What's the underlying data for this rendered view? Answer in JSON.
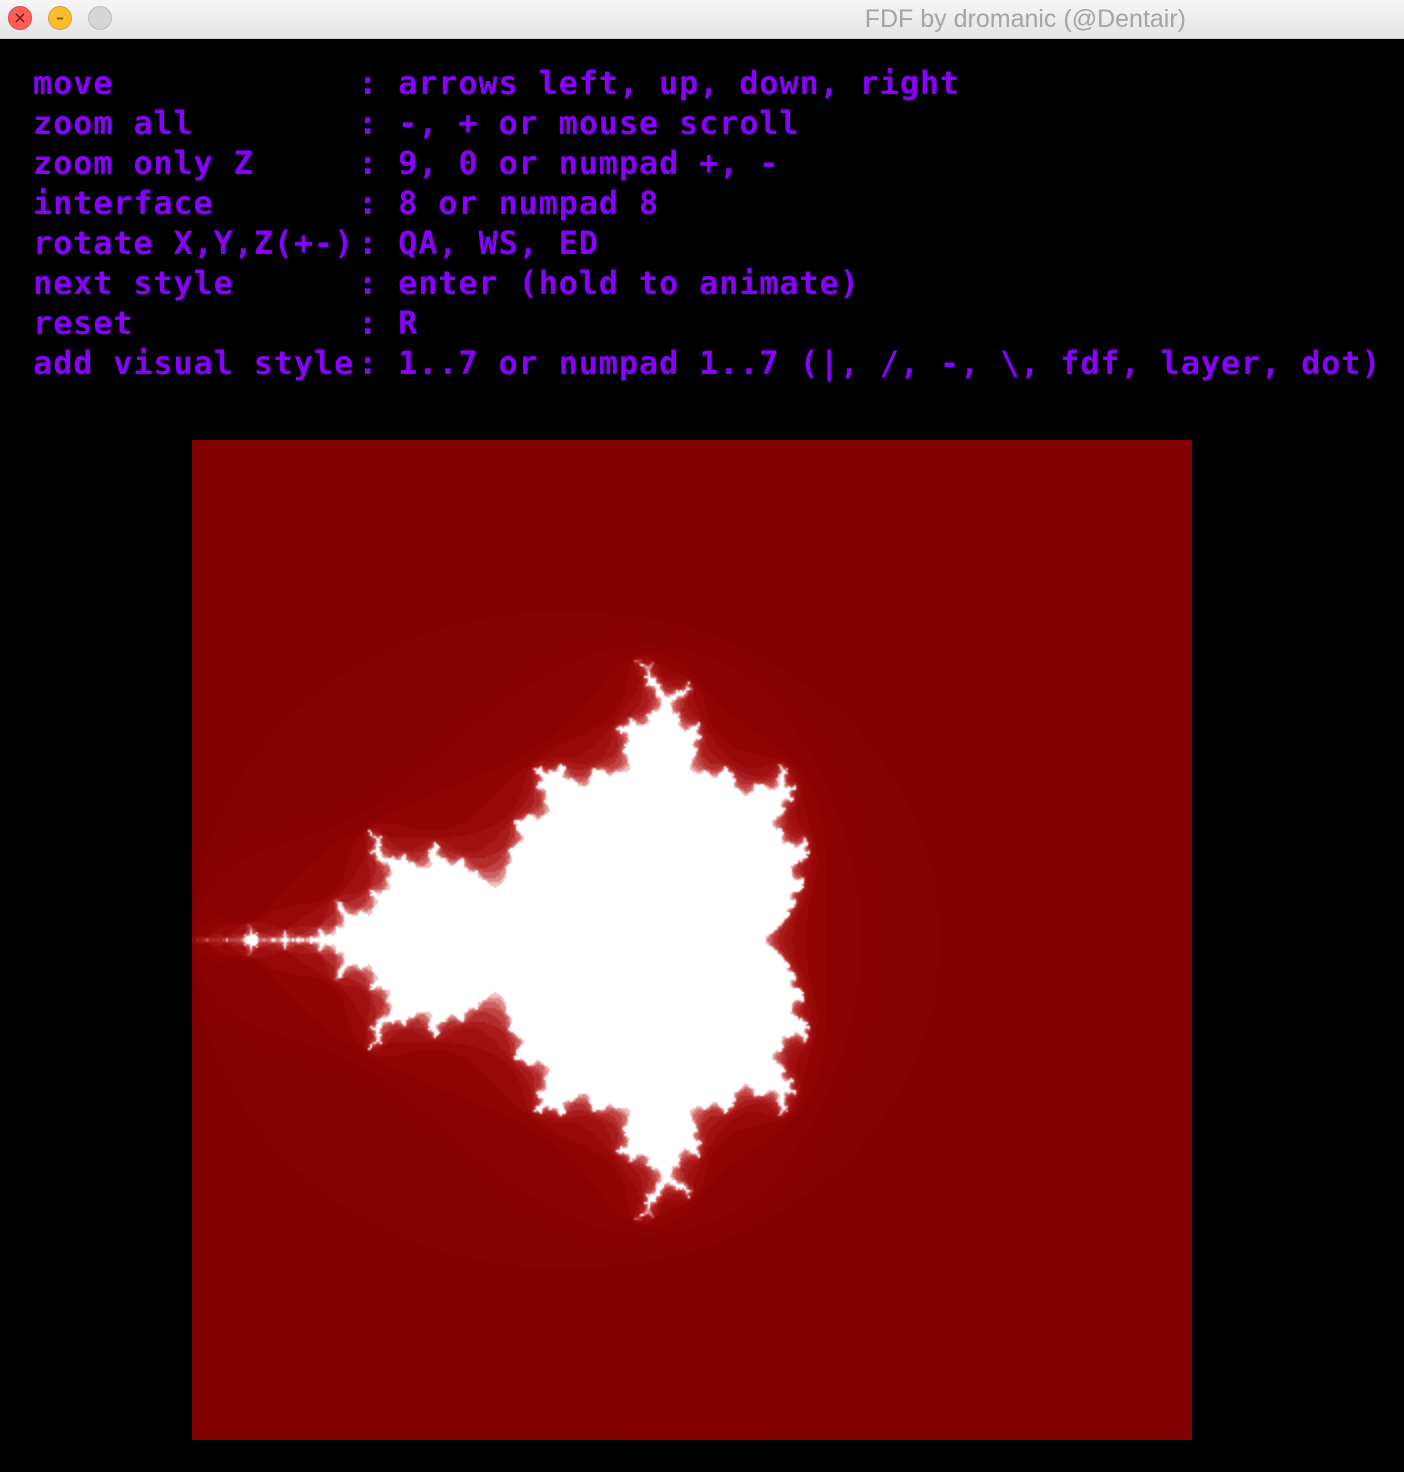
{
  "window": {
    "title": "FDF by dromanic (@Dentair)"
  },
  "help": [
    {
      "key": "move",
      "value": ": arrows left, up, down, right"
    },
    {
      "key": "zoom all",
      "value": ": -, + or mouse scroll"
    },
    {
      "key": "zoom only Z",
      "value": ": 9, 0 or numpad +, -"
    },
    {
      "key": "interface",
      "value": ": 8 or numpad 8"
    },
    {
      "key": "rotate X,Y,Z(+-)",
      "value": ": QA, WS, ED"
    },
    {
      "key": "next style",
      "value": ": enter (hold to animate)"
    },
    {
      "key": "reset",
      "value": ": R"
    },
    {
      "key": "add visual style",
      "value": ": 1..7 or numpad 1..7 (|, /, -, \\, fdf, layer, dot)"
    }
  ],
  "colors": {
    "help_text": "#8a00ff",
    "fractal_background": "#800000",
    "fractal_set": "#ffffff",
    "window_background": "#000000"
  }
}
